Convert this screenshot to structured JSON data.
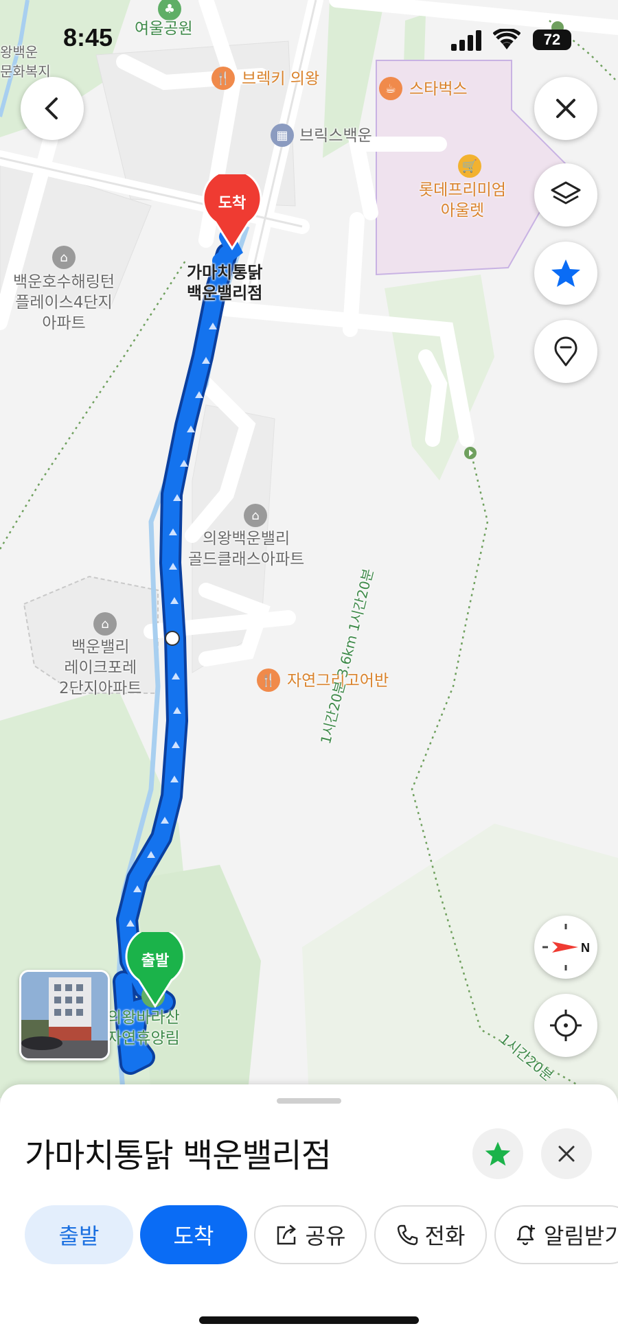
{
  "status_bar": {
    "time": "8:45",
    "battery": "72"
  },
  "map": {
    "labels": {
      "park": "여울공원",
      "culture": "왕백운\n문화복지",
      "breck": "브렉키 의왕",
      "starbucks": "스타벅스",
      "bricks": "브릭스백운",
      "lotte": "롯데프리미엄\n아울렛",
      "apt4": "백운호수해링턴\n플레이스4단지\n아파트",
      "destination": "가마치통닭\n백운밸리점",
      "goldclass": "의왕백운밸리\n골드클래스아파트",
      "lakeforet": "백운밸리\n레이크포레\n2단지아파트",
      "restaurant": "자연그리고어반",
      "forest": "의왕바라산\n자연휴양림",
      "trail1": "1시간20분 3.6km 1시간20분",
      "trail2": "1시간20분"
    },
    "markers": {
      "arrive": "도착",
      "start": "출발"
    }
  },
  "controls": {
    "back": "back",
    "close": "close",
    "layers": "layers",
    "favorites": "favorites",
    "pin": "pin",
    "compass": "N",
    "locate": "locate"
  },
  "sheet": {
    "title": "가마치통닭 백운밸리점",
    "actions": {
      "start": "출발",
      "arrive": "도착",
      "share": "공유",
      "call": "전화",
      "notify": "알림받기"
    }
  },
  "colors": {
    "route": "#0a6cf5",
    "arrive_marker": "#ef3b32",
    "start_marker": "#1bb34a",
    "star": "#1bb34a"
  }
}
